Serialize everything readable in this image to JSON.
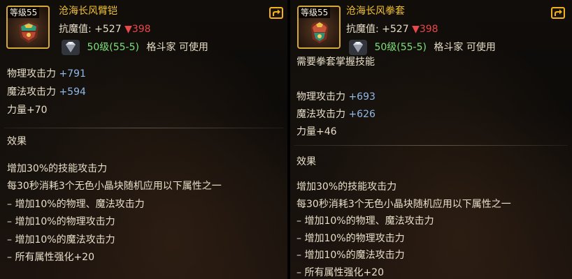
{
  "left": {
    "level_badge": "等级55",
    "name": "沧海长风臂铠",
    "resist_label": "抗魔值:",
    "resist_plus": "+527",
    "resist_down": "▼398",
    "req_level": "50级(55-5)",
    "req_text": "格斗家 可使用",
    "stats": [
      {
        "label": "物理攻击力",
        "value": "+791"
      },
      {
        "label": "魔法攻击力",
        "value": "+594"
      }
    ],
    "strength": "力量+70",
    "effect_title": "效果",
    "effects": [
      "增加30%的技能攻击力",
      "每30秒消耗3个无色小晶块随机应用以下属性之一",
      "– 增加10%的物理、魔法攻击力",
      "– 增加10%的物理攻击力",
      "– 增加10%的魔法攻击力",
      "– 所有属性强化+20"
    ]
  },
  "right": {
    "level_badge": "等级55",
    "name": "沧海长风拳套",
    "resist_label": "抗魔值:",
    "resist_plus": "+527",
    "resist_down": "▼398",
    "req_level": "50级(55-5)",
    "req_text": "格斗家 可使用",
    "skill_req": "需要拳套掌握技能",
    "stats": [
      {
        "label": "物理攻击力",
        "value": "+693"
      },
      {
        "label": "魔法攻击力",
        "value": "+626"
      }
    ],
    "strength": "力量+46",
    "effect_title": "效果",
    "effects": [
      "增加30%的技能攻击力",
      "每30秒消耗3个无色小晶块随机应用以下属性之一",
      "– 增加10%的物理、魔法攻击力",
      "– 增加10%的物理攻击力",
      "– 增加10%的魔法攻击力",
      "– 所有属性强化+20"
    ]
  },
  "icons": {
    "share": "share-icon",
    "gem": "diamond-gem-icon",
    "left_item": "arm-guard-icon",
    "right_item": "gauntlet-icon"
  },
  "colors": {
    "name_gold": "#f2c230",
    "stat_blue": "#8fb9e8",
    "req_green": "#7fe07a",
    "down_red": "#e8484a"
  }
}
